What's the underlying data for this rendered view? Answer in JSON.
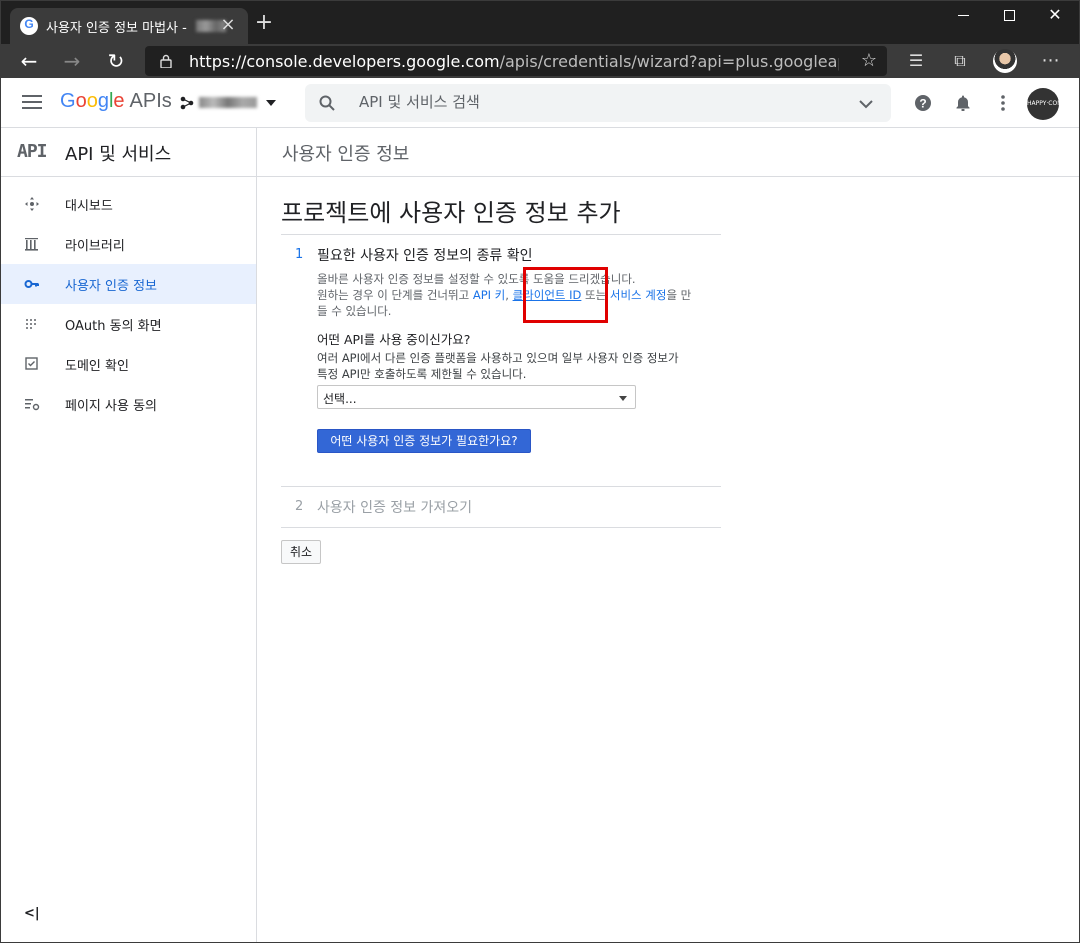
{
  "browser": {
    "tab_title": "사용자 인증 정보 마법사 - ",
    "new_tab_label": "+",
    "url_main": "https://console.developers.google.com",
    "url_rest": "/apis/credentials/wizard?api=plus.googleapis.com&...",
    "more_label": "⋯"
  },
  "header": {
    "logo_google": "Google",
    "logo_apis": "APIs",
    "search_placeholder": "API 및 서비스 검색",
    "avatar_text": "HAPPY COM"
  },
  "sidebar": {
    "logo": "API",
    "title": "API 및 서비스",
    "items": [
      {
        "label": "대시보드",
        "icon": "dashboard-icon"
      },
      {
        "label": "라이브러리",
        "icon": "library-icon"
      },
      {
        "label": "사용자 인증 정보",
        "icon": "key-icon",
        "active": true
      },
      {
        "label": "OAuth 동의 화면",
        "icon": "oauth-icon"
      },
      {
        "label": "도메인 확인",
        "icon": "domain-check-icon"
      },
      {
        "label": "페이지 사용 동의",
        "icon": "page-consent-icon"
      }
    ],
    "collapse_label": "<|"
  },
  "main": {
    "page_header": "사용자 인증 정보",
    "heading": "프로젝트에 사용자 인증 정보 추가",
    "step1": {
      "num": "1",
      "title": "필요한 사용자 인증 정보의 종류 확인",
      "desc_line1": "올바른 사용자 인증 정보를 설정할 수 있도록 도움을 드리겠습니다.",
      "desc_line2_pre": "원하는 경우 이 단계를 건너뛰고 ",
      "link_api_key": "API 키",
      "desc_comma": ", ",
      "link_client_id": "클라이언트 ID",
      "desc_mid": " 또는 ",
      "link_service_account": "서비스 계정",
      "desc_end": "을 만들 수 있습니다.",
      "question": "어떤 API를 사용 중이신가요?",
      "question_desc": "여러 API에서 다른 인증 플랫폼을 사용하고 있으며 일부 사용자 인증 정보가 특정 API만 호출하도록 제한될 수 있습니다.",
      "select_value": "선택...",
      "primary_button": "어떤 사용자 인증 정보가 필요한가요?"
    },
    "step2": {
      "num": "2",
      "title": "사용자 인증 정보 가져오기"
    },
    "cancel_button": "취소"
  }
}
